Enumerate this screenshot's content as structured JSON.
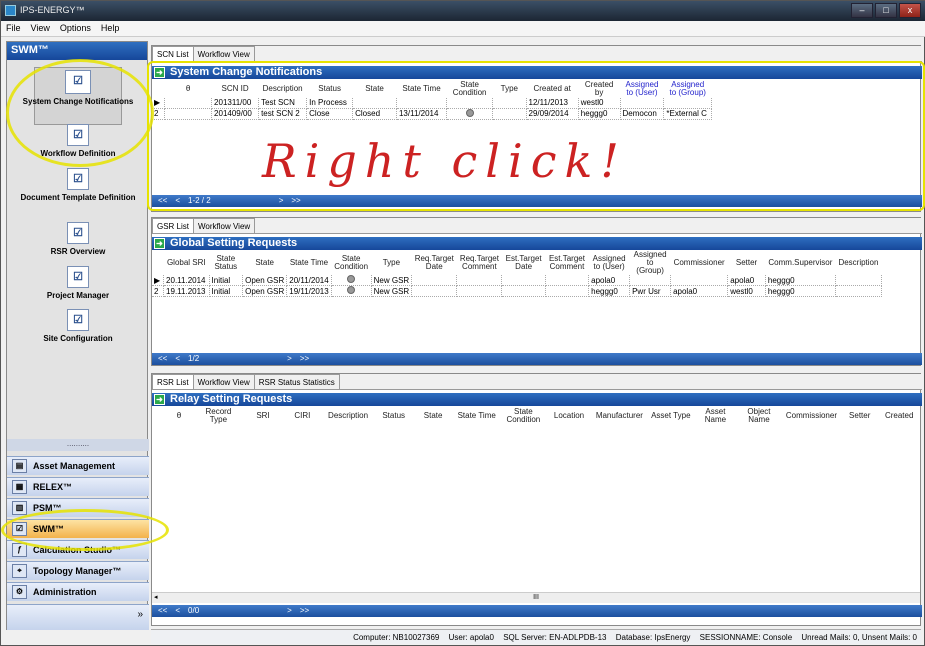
{
  "window": {
    "title": "IPS-ENERGY™",
    "controls": [
      "–",
      "□",
      "x"
    ]
  },
  "menu": [
    "File",
    "View",
    "Options",
    "Help"
  ],
  "sidebar": {
    "title": "SWM™",
    "items": [
      {
        "label": "System Change Notifications"
      },
      {
        "label": "Workflow Definition"
      },
      {
        "label": "Document Template Definition"
      },
      {
        "label": "RSR Overview"
      },
      {
        "label": "Project Manager"
      },
      {
        "label": "Site Configuration"
      }
    ],
    "separator": "..........",
    "modules": [
      {
        "label": "Asset Management",
        "icon": "asset-icon"
      },
      {
        "label": "RELEX™",
        "icon": "relex-icon"
      },
      {
        "label": "PSM™",
        "icon": "psm-icon"
      },
      {
        "label": "SWM™",
        "icon": "swm-icon"
      },
      {
        "label": "Calculation Studio™",
        "icon": "calc-icon"
      },
      {
        "label": "Topology Manager™",
        "icon": "topology-icon"
      },
      {
        "label": "Administration",
        "icon": "admin-icon"
      }
    ],
    "footer": "»"
  },
  "scn": {
    "tabs": [
      "SCN List",
      "Workflow View"
    ],
    "title": "System Change Notifications",
    "columns": [
      "θ",
      "SCN ID",
      "Description",
      "Status",
      "State",
      "State Time",
      "State Condition",
      "Type",
      "Created at",
      "Created by",
      "Assigned to (User)",
      "Assigned to (Group)"
    ],
    "rows": [
      {
        "n": "",
        "id": "201311/00",
        "desc": "Test SCN",
        "status": "In Process",
        "state": "",
        "time": "",
        "cond": false,
        "type": "",
        "created": "12/11/2013",
        "by": "westl0",
        "user": "",
        "group": ""
      },
      {
        "n": "2",
        "id": "201409/00",
        "desc": "test SCN 2",
        "status": "Close",
        "state": "Closed",
        "time": "13/11/2014",
        "cond": true,
        "type": "",
        "created": "29/09/2014",
        "by": "heggg0",
        "user": "Democon",
        "group": "*External C"
      }
    ],
    "nav": [
      "<<",
      "<",
      "1-2 / 2",
      ">",
      ">>"
    ],
    "annotation": "Right click!"
  },
  "gsr": {
    "tabs": [
      "GSR List",
      "Workflow View"
    ],
    "title": "Global Setting Requests",
    "columns": [
      "Global SRI",
      "State Status",
      "State",
      "State Time",
      "State Condition",
      "Type",
      "Req.Target Date",
      "Req.Target Comment",
      "Est.Target Date",
      "Est.Target Comment",
      "Assigned to (User)",
      "Assigned to (Group)",
      "Commissioner",
      "Setter",
      "Comm.Supervisor",
      "Description"
    ],
    "rows": [
      {
        "n": "",
        "sri": "20.11.2014",
        "ss": "Initial",
        "state": "Open GSR",
        "time": "20/11/2014",
        "type": "New GSR",
        "user": "apola0",
        "group": "",
        "comm": "",
        "setter": "apola0",
        "sup": "heggg0"
      },
      {
        "n": "2",
        "sri": "19.11.2013",
        "ss": "Initial",
        "state": "Open GSR",
        "time": "19/11/2013",
        "type": "New GSR",
        "user": "heggg0",
        "group": "Pwr Usr",
        "comm": "apola0",
        "setter": "westl0",
        "sup": "heggg0"
      }
    ],
    "nav": [
      "<<",
      "<",
      "1/2",
      ">",
      ">>"
    ]
  },
  "rsr": {
    "tabs": [
      "RSR List",
      "Workflow View",
      "RSR Status Statistics"
    ],
    "title": "Relay Setting Requests",
    "columns": [
      "θ",
      "Record Type",
      "SRI",
      "CIRI",
      "Description",
      "Status",
      "State",
      "State Time",
      "State Condition",
      "Location",
      "Manufacturer",
      "Asset Type",
      "Asset Name",
      "Object Name",
      "Commissioner",
      "Setter",
      "Created"
    ],
    "nav": [
      "<<",
      "<",
      "0/0",
      ">",
      ">>"
    ],
    "scroll": "III"
  },
  "status": [
    "Computer: NB10027369",
    "User: apola0",
    "SQL Server: EN-ADLPDB-13",
    "Database: IpsEnergy",
    "SESSIONNAME: Console",
    "Unread Mails: 0, Unsent Mails: 0"
  ],
  "colors": {
    "header": "#2f6fc0",
    "highlight": "#e6e300",
    "annotation": "#c22222"
  }
}
